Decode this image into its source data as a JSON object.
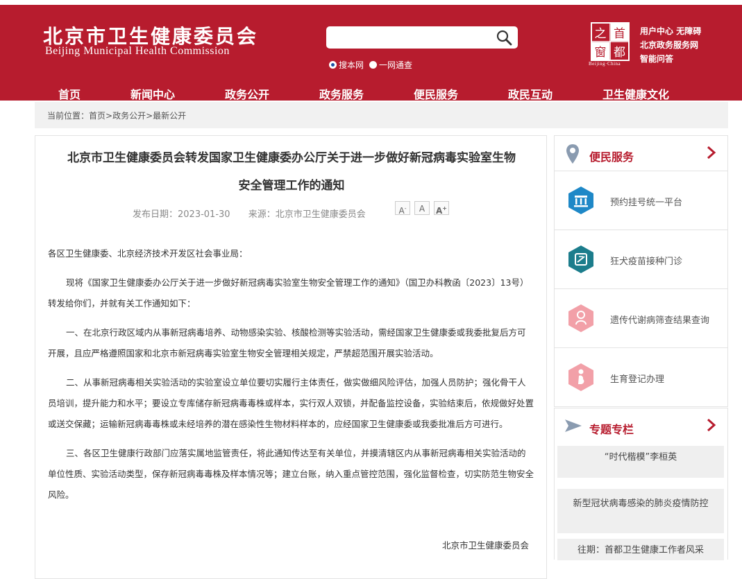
{
  "header": {
    "logo_cn": "北京市卫生健康委员会",
    "logo_en": "Beijing Municipal Health Commission",
    "search": {
      "placeholder": "",
      "value": ""
    },
    "radios": [
      {
        "label": "搜本网",
        "checked": true
      },
      {
        "label": "一网通查",
        "checked": false
      }
    ],
    "seal": {
      "chars": [
        "之",
        "首",
        "窗",
        "都"
      ],
      "sub": "Beijing·China"
    },
    "quick_links": [
      "用户中心",
      "无障碍",
      "北京政务服务网",
      "智能问答"
    ]
  },
  "nav": {
    "items": [
      "首页",
      "新闻中心",
      "政务公开",
      "政务服务",
      "便民服务",
      "政民互动",
      "卫生健康文化"
    ]
  },
  "breadcrumb": {
    "prefix": "当前位置：",
    "path": "首页>政务公开>最新公开"
  },
  "article": {
    "title_line1": "北京市卫生健康委员会转发国家卫生健康委办公厅关于进一步做好新冠病毒实验室生物",
    "title_line2": "安全管理工作的通知",
    "date": "发布日期：2023-01-30",
    "source": "来源：北京市卫生健康委员会",
    "font_buttons": [
      "A-",
      "A",
      "A+"
    ],
    "salutation": "各区卫生健康委、北京经济技术开发区社会事业局：",
    "paragraphs": [
      "现将《国家卫生健康委办公厅关于进一步做好新冠病毒实验室生物安全管理工作的通知》（国卫办科教函〔2023〕13号）转发给你们，并就有关工作通知如下：",
      "一、在北京行政区域内从事新冠病毒培养、动物感染实验、核酸检测等实验活动，需经国家卫生健康委或我委批复后方可开展，且应严格遵照国家和北京市新冠病毒实验室生物安全管理相关规定，严禁超范围开展实验活动。",
      "二、从事新冠病毒相关实验活动的实验室设立单位要切实履行主体责任，做实做细风险评估，加强人员防护；强化骨干人员培训，提升能力和水平；要设立专库储存新冠病毒毒株或样本，实行双人双锁，并配备监控设备，实验结束后，依规做好处置或送交保藏；运输新冠病毒毒株或未经培养的潜在感染性生物材料样本的，应经国家卫生健康委或我委批准后方可进行。",
      "三、各区卫生健康行政部门应落实属地监管责任，将此通知传达至有关单位，并摸清辖区内从事新冠病毒相关实验活动的单位性质、实验活动类型，保存新冠病毒毒株及样本情况等；建立台账，纳入重点管控范围，强化监督检查，切实防范生物安全风险。"
    ],
    "signature": "北京市卫生健康委员会"
  },
  "sidebar": {
    "title": "便民服务",
    "items": [
      {
        "label": "预约挂号统一平台",
        "icon": "hospital-icon",
        "color": "#1e88c7"
      },
      {
        "label": "狂犬疫苗接种门诊",
        "icon": "vaccine-icon",
        "color": "#1c7d8c"
      },
      {
        "label": "遗传代谢病筛查结果查询",
        "icon": "baby-icon",
        "color": "#f2a0a8"
      },
      {
        "label": "生育登记办理",
        "icon": "mother-icon",
        "color": "#f2a0a8"
      }
    ]
  },
  "topics": {
    "title": "专题专栏",
    "items": [
      "“时代楷模”李桓英",
      "新型冠状病毒感染的肺炎疫情防控",
      "往期：首都卫生健康工作者风采"
    ]
  },
  "colors": {
    "brand_red": "#b71c2e",
    "breadcrumb_bg": "#f1f1f1"
  }
}
